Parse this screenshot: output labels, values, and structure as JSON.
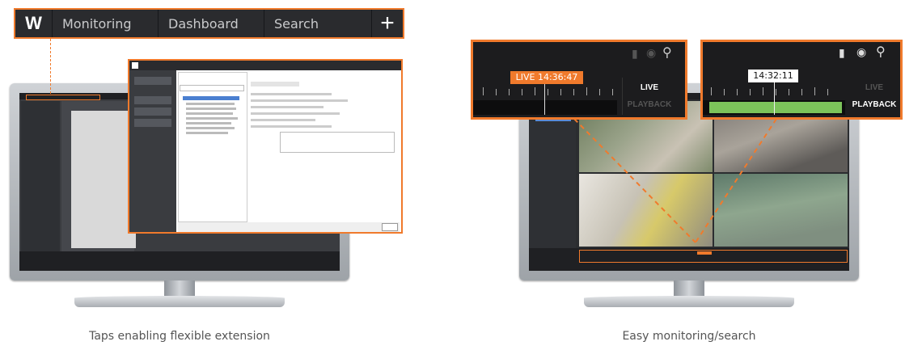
{
  "menubar": {
    "logo": "W",
    "tabs": [
      "Monitoring",
      "Dashboard",
      "Search"
    ],
    "add_label": "+"
  },
  "captions": {
    "left": "Taps enabling flexible extension",
    "right": "Easy monitoring/search"
  },
  "timeline_live": {
    "time_label": "LIVE 14:36:47",
    "live_label": "LIVE",
    "playback_label": "PLAYBACK"
  },
  "timeline_playback": {
    "time_label": "14:32:11",
    "live_label": "LIVE",
    "playback_label": "PLAYBACK"
  },
  "icons": [
    "bookmark-icon",
    "camera-icon",
    "search-icon",
    "plus-icon"
  ],
  "colors": {
    "accent": "#f07a2c",
    "dark": "#2a2b2e",
    "playback_green": "#7cc35a"
  }
}
